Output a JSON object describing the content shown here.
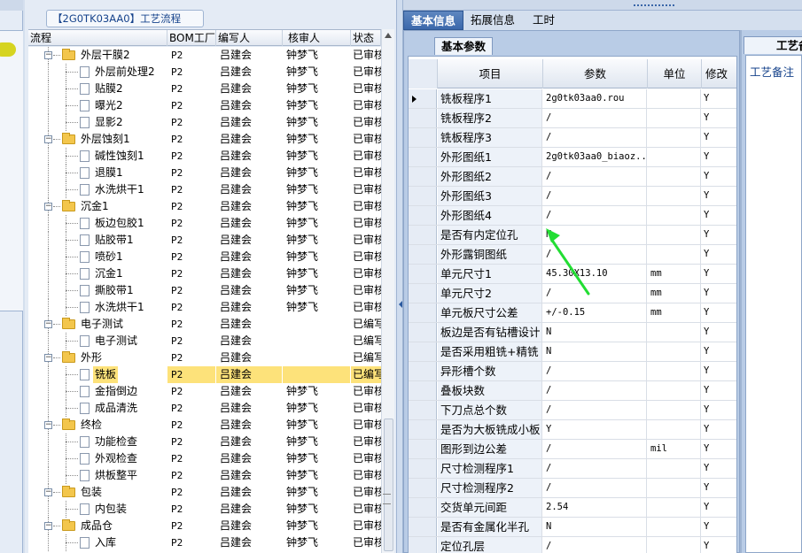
{
  "tree_panel": {
    "title": "【2G0TK03AA0】工艺流程",
    "columns": [
      "流程",
      "BOM工厂",
      "编写人",
      "核审人",
      "状态"
    ],
    "rows": [
      {
        "name": "外层干膜2",
        "type": "folder",
        "bom": "P2",
        "writer": "吕建会",
        "reviewer": "钟梦飞",
        "status": "已审核"
      },
      {
        "name": "外层前处理2",
        "type": "doc",
        "bom": "P2",
        "writer": "吕建会",
        "reviewer": "钟梦飞",
        "status": "已审核"
      },
      {
        "name": "贴膜2",
        "type": "doc",
        "bom": "P2",
        "writer": "吕建会",
        "reviewer": "钟梦飞",
        "status": "已审核"
      },
      {
        "name": "曝光2",
        "type": "doc",
        "bom": "P2",
        "writer": "吕建会",
        "reviewer": "钟梦飞",
        "status": "已审核"
      },
      {
        "name": "显影2",
        "type": "doc",
        "bom": "P2",
        "writer": "吕建会",
        "reviewer": "钟梦飞",
        "status": "已审核"
      },
      {
        "name": "外层蚀刻1",
        "type": "folder",
        "bom": "P2",
        "writer": "吕建会",
        "reviewer": "钟梦飞",
        "status": "已审核"
      },
      {
        "name": "碱性蚀刻1",
        "type": "doc",
        "bom": "P2",
        "writer": "吕建会",
        "reviewer": "钟梦飞",
        "status": "已审核"
      },
      {
        "name": "退膜1",
        "type": "doc",
        "bom": "P2",
        "writer": "吕建会",
        "reviewer": "钟梦飞",
        "status": "已审核"
      },
      {
        "name": "水洗烘干1",
        "type": "doc",
        "bom": "P2",
        "writer": "吕建会",
        "reviewer": "钟梦飞",
        "status": "已审核"
      },
      {
        "name": "沉金1",
        "type": "folder",
        "bom": "P2",
        "writer": "吕建会",
        "reviewer": "钟梦飞",
        "status": "已审核"
      },
      {
        "name": "板边包胶1",
        "type": "doc",
        "bom": "P2",
        "writer": "吕建会",
        "reviewer": "钟梦飞",
        "status": "已审核"
      },
      {
        "name": "贴胶带1",
        "type": "doc",
        "bom": "P2",
        "writer": "吕建会",
        "reviewer": "钟梦飞",
        "status": "已审核"
      },
      {
        "name": "喷砂1",
        "type": "doc",
        "bom": "P2",
        "writer": "吕建会",
        "reviewer": "钟梦飞",
        "status": "已审核"
      },
      {
        "name": "沉金1",
        "type": "doc",
        "bom": "P2",
        "writer": "吕建会",
        "reviewer": "钟梦飞",
        "status": "已审核"
      },
      {
        "name": "撕胶带1",
        "type": "doc",
        "bom": "P2",
        "writer": "吕建会",
        "reviewer": "钟梦飞",
        "status": "已审核"
      },
      {
        "name": "水洗烘干1",
        "type": "doc",
        "bom": "P2",
        "writer": "吕建会",
        "reviewer": "钟梦飞",
        "status": "已审核"
      },
      {
        "name": "电子测试",
        "type": "folder",
        "bom": "P2",
        "writer": "吕建会",
        "reviewer": "",
        "status": "已编写"
      },
      {
        "name": "电子测试",
        "type": "doc",
        "bom": "P2",
        "writer": "吕建会",
        "reviewer": "",
        "status": "已编写"
      },
      {
        "name": "外形",
        "type": "folder",
        "bom": "P2",
        "writer": "吕建会",
        "reviewer": "",
        "status": "已编写"
      },
      {
        "name": "铣板",
        "type": "doc",
        "bom": "P2",
        "writer": "吕建会",
        "reviewer": "",
        "status": "已编写",
        "selected": true
      },
      {
        "name": "金指倒边",
        "type": "doc",
        "bom": "P2",
        "writer": "吕建会",
        "reviewer": "钟梦飞",
        "status": "已审核"
      },
      {
        "name": "成品清洗",
        "type": "doc",
        "bom": "P2",
        "writer": "吕建会",
        "reviewer": "钟梦飞",
        "status": "已审核"
      },
      {
        "name": "终检",
        "type": "folder",
        "bom": "P2",
        "writer": "吕建会",
        "reviewer": "钟梦飞",
        "status": "已审核"
      },
      {
        "name": "功能检查",
        "type": "doc",
        "bom": "P2",
        "writer": "吕建会",
        "reviewer": "钟梦飞",
        "status": "已审核"
      },
      {
        "name": "外观检查",
        "type": "doc",
        "bom": "P2",
        "writer": "吕建会",
        "reviewer": "钟梦飞",
        "status": "已审核"
      },
      {
        "name": "烘板整平",
        "type": "doc",
        "bom": "P2",
        "writer": "吕建会",
        "reviewer": "钟梦飞",
        "status": "已审核"
      },
      {
        "name": "包装",
        "type": "folder",
        "bom": "P2",
        "writer": "吕建会",
        "reviewer": "钟梦飞",
        "status": "已审核"
      },
      {
        "name": "内包装",
        "type": "doc",
        "bom": "P2",
        "writer": "吕建会",
        "reviewer": "钟梦飞",
        "status": "已审核"
      },
      {
        "name": "成品仓",
        "type": "folder",
        "bom": "P2",
        "writer": "吕建会",
        "reviewer": "钟梦飞",
        "status": "已审核"
      },
      {
        "name": "入库",
        "type": "doc",
        "bom": "P2",
        "writer": "吕建会",
        "reviewer": "钟梦飞",
        "status": "已审核"
      }
    ]
  },
  "tabs": [
    "基本信息",
    "拓展信息",
    "工时"
  ],
  "inner_tab": "基本参数",
  "grid": {
    "columns": [
      "项目",
      "参数",
      "单位",
      "修改"
    ],
    "rows": [
      {
        "item": "铣板程序1",
        "value": "2g0tk03aa0.rou",
        "unit": "",
        "mod": "Y",
        "current": true
      },
      {
        "item": "铣板程序2",
        "value": "/",
        "unit": "",
        "mod": "Y"
      },
      {
        "item": "铣板程序3",
        "value": "/",
        "unit": "",
        "mod": "Y"
      },
      {
        "item": "外形图纸1",
        "value": "2g0tk03aa0_biaoz...",
        "unit": "",
        "mod": "Y"
      },
      {
        "item": "外形图纸2",
        "value": "/",
        "unit": "",
        "mod": "Y"
      },
      {
        "item": "外形图纸3",
        "value": "/",
        "unit": "",
        "mod": "Y"
      },
      {
        "item": "外形图纸4",
        "value": "/",
        "unit": "",
        "mod": "Y"
      },
      {
        "item": "是否有内定位孔",
        "value": "N",
        "unit": "",
        "mod": "Y"
      },
      {
        "item": "外形露铜图纸",
        "value": "/",
        "unit": "",
        "mod": "Y"
      },
      {
        "item": "单元尺寸1",
        "value": "45.30X13.10",
        "unit": "mm",
        "mod": "Y"
      },
      {
        "item": "单元尺寸2",
        "value": "/",
        "unit": "mm",
        "mod": "Y"
      },
      {
        "item": "单元板尺寸公差",
        "value": "+/-0.15",
        "unit": "mm",
        "mod": "Y"
      },
      {
        "item": "板边是否有钻槽设计",
        "value": "N",
        "unit": "",
        "mod": "Y"
      },
      {
        "item": "是否采用粗铣+精铣",
        "value": "N",
        "unit": "",
        "mod": "Y"
      },
      {
        "item": "异形槽个数",
        "value": "/",
        "unit": "",
        "mod": "Y"
      },
      {
        "item": "叠板块数",
        "value": "/",
        "unit": "",
        "mod": "Y"
      },
      {
        "item": "下刀点总个数",
        "value": "/",
        "unit": "",
        "mod": "Y"
      },
      {
        "item": "是否为大板铣成小板",
        "value": "Y",
        "unit": "",
        "mod": "Y"
      },
      {
        "item": "图形到边公差",
        "value": "/",
        "unit": "mil",
        "mod": "Y"
      },
      {
        "item": "尺寸检测程序1",
        "value": "/",
        "unit": "",
        "mod": "Y"
      },
      {
        "item": "尺寸检测程序2",
        "value": "/",
        "unit": "",
        "mod": "Y"
      },
      {
        "item": "交货单元间距",
        "value": "2.54",
        "unit": "",
        "mod": "Y"
      },
      {
        "item": "是否有金属化半孔",
        "value": "N",
        "unit": "",
        "mod": "Y"
      },
      {
        "item": "定位孔层",
        "value": "/",
        "unit": "",
        "mod": "Y"
      }
    ]
  },
  "far_right": {
    "tab": "工艺备注",
    "memo_label": "工艺备注"
  },
  "colors": {
    "selection": "#fde27a",
    "tab_active": "#3b68ab",
    "annotation_arrow": "#22dd33"
  }
}
